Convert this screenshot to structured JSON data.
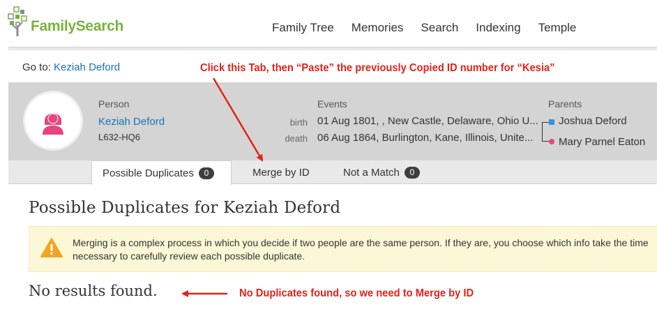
{
  "header": {
    "logo_text": "FamilySearch",
    "nav": [
      "Family Tree",
      "Memories",
      "Search",
      "Indexing",
      "Temple"
    ]
  },
  "goto": {
    "label": "Go to:",
    "link": "Keziah Deford"
  },
  "annotations": {
    "top": "Click this Tab, then “Paste” the previously Copied ID number for “Kesia”",
    "bottom": "No Duplicates found, so we need to Merge by ID"
  },
  "person": {
    "label": "Person",
    "name": "Keziah Deford",
    "id": "L632-HQ6",
    "avatar_icon": "female-person-icon"
  },
  "events": {
    "label": "Events",
    "items": [
      {
        "type": "birth",
        "value": "01 Aug 1801, , New Castle, Delaware, Ohio U..."
      },
      {
        "type": "death",
        "value": "06 Aug 1864, Burlington, Kane, Illinois, Unite..."
      }
    ]
  },
  "parents": {
    "label": "Parents",
    "father": "Joshua Deford",
    "mother": "Mary Parnel Eaton"
  },
  "tabs": [
    {
      "label": "Possible Duplicates",
      "count": "0",
      "active": true
    },
    {
      "label": "Merge by ID",
      "active": false
    },
    {
      "label": "Not a Match",
      "count": "0",
      "active": false
    }
  ],
  "page_title": "Possible Duplicates for Keziah Deford",
  "warning": {
    "icon": "warning-icon",
    "text": "Merging is a complex process in which you decide if two people are the same person. If they are, you choose which info take the time necessary to carefully review each possible duplicate."
  },
  "no_results": "No results found.",
  "colors": {
    "brand_green": "#7ab23e",
    "link_blue": "#1a73b5",
    "annotation_red": "#e2231a",
    "female_pink": "#e8457d"
  }
}
